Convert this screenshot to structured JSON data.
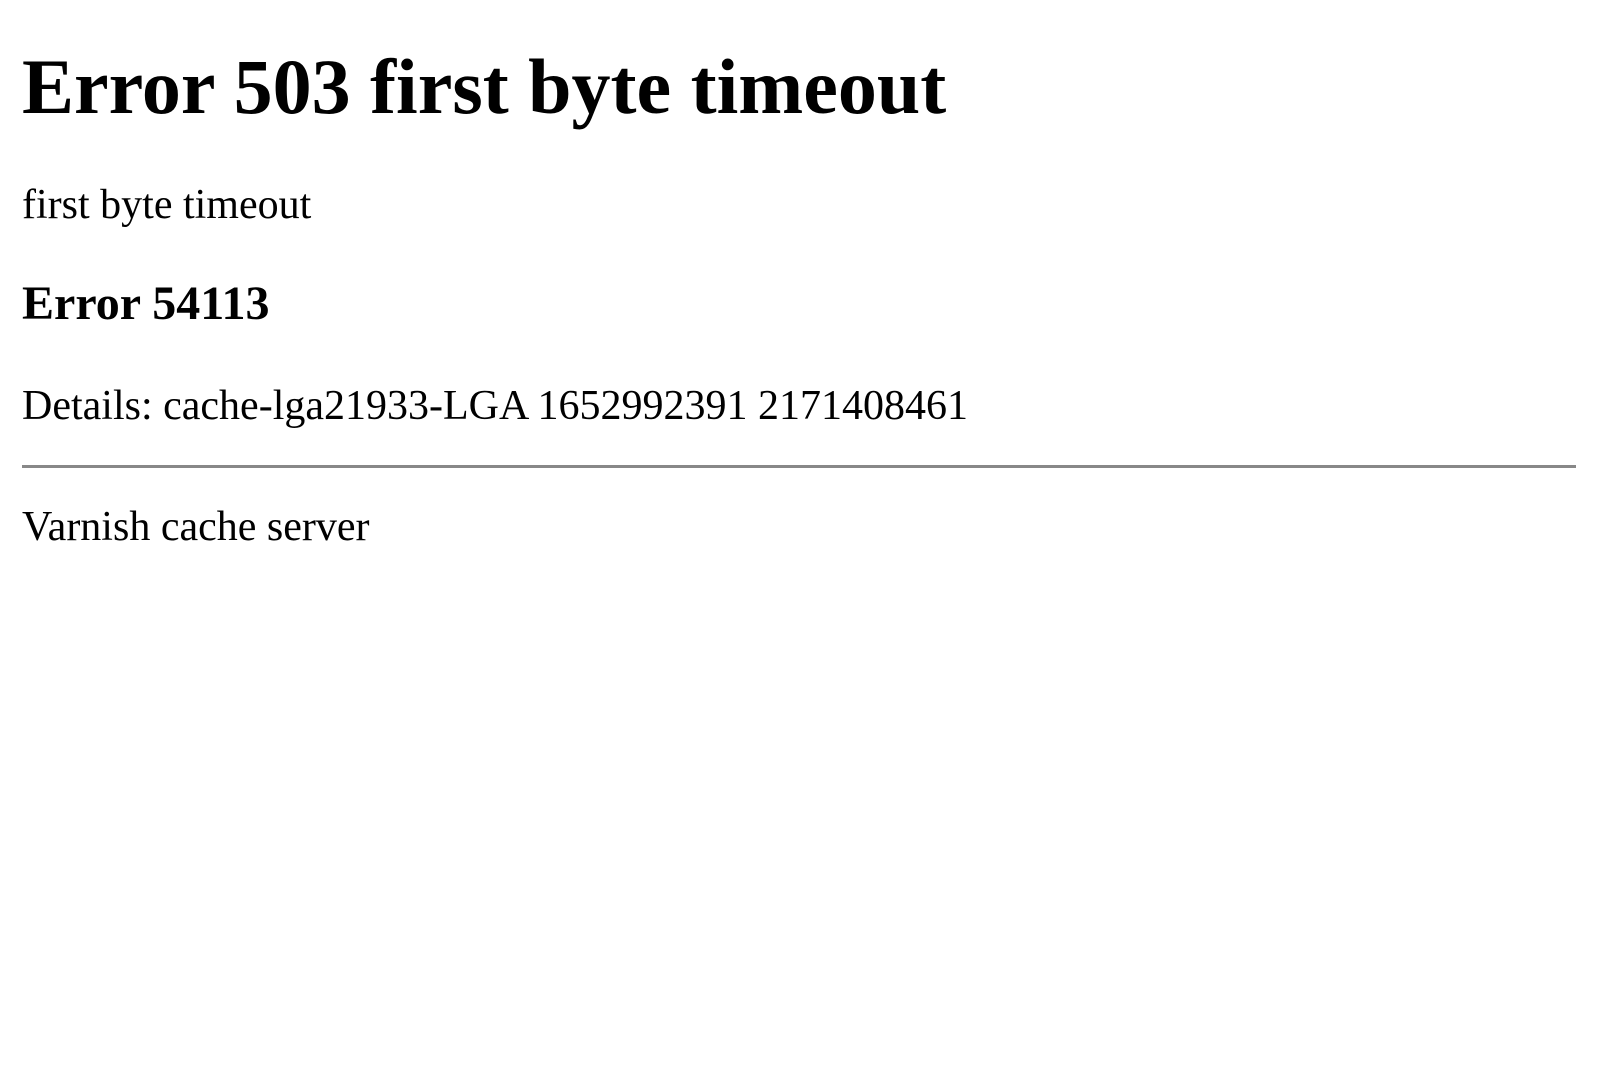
{
  "error": {
    "heading": "Error 503 first byte timeout",
    "message": "first byte timeout",
    "code": "Error 54113",
    "details": "Details: cache-lga21933-LGA 1652992391 2171408461",
    "server": "Varnish cache server"
  }
}
